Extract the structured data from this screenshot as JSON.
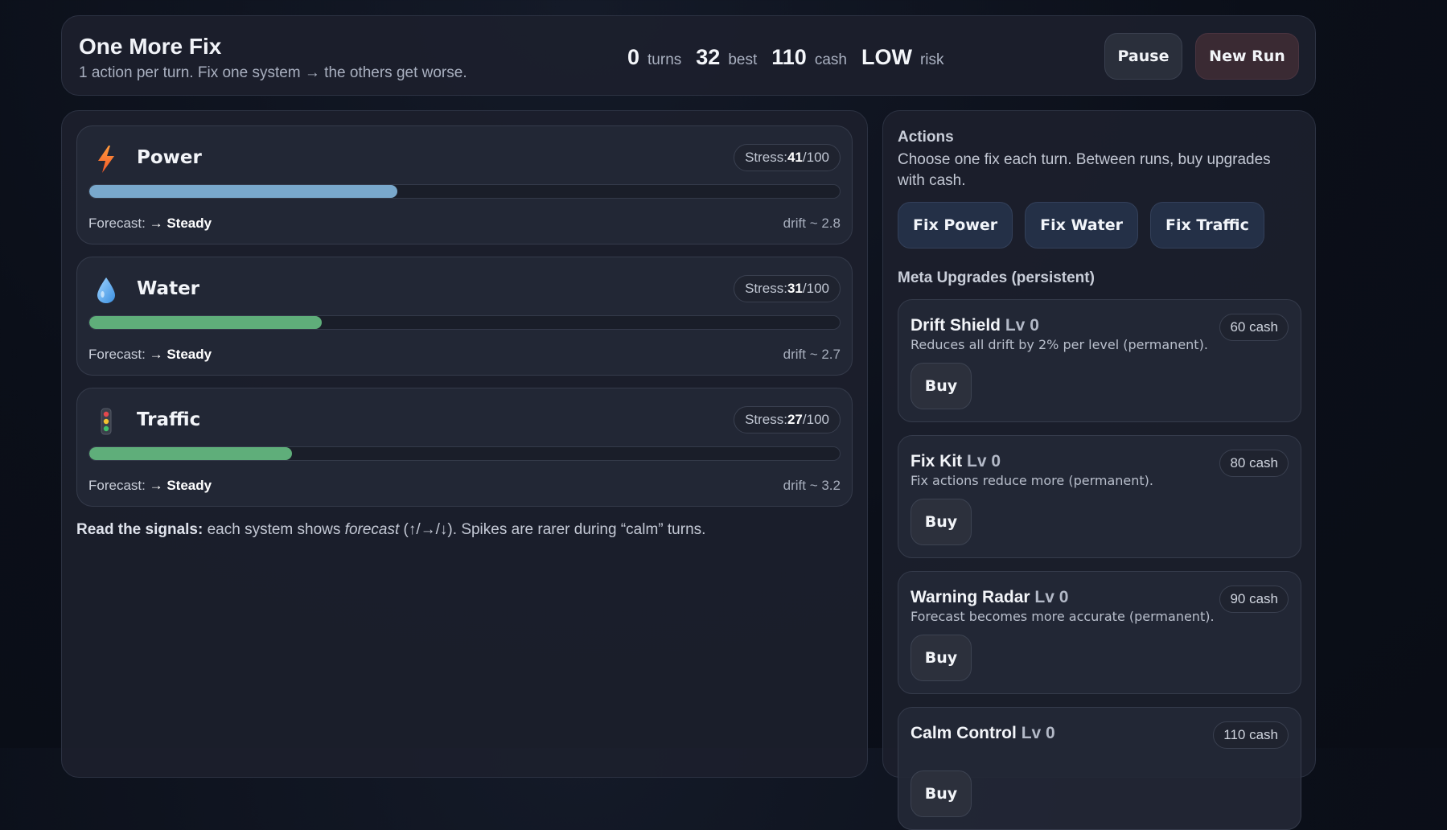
{
  "header": {
    "title": "One More Fix",
    "subtitle": "1 action per turn. Fix one system → the others get worse.",
    "stats": [
      {
        "value": "0",
        "label": "turns"
      },
      {
        "value": "32",
        "label": "best"
      },
      {
        "value": "110",
        "label": "cash"
      },
      {
        "value": "LOW",
        "label": "risk"
      }
    ],
    "pause_label": "Pause",
    "new_run_label": "New Run"
  },
  "systems": [
    {
      "name": "Power",
      "icon": "lightning-bolt-icon",
      "stress": "41",
      "stress_max": "100",
      "stress_prefix": "Stress: ",
      "forecast_prefix": "Forecast: ",
      "forecast": "→ Steady",
      "drift": "drift ~ 2.8",
      "bar_color": "#79a8cc",
      "fill_fraction": 0.41
    },
    {
      "name": "Water",
      "icon": "water-drop-icon",
      "stress": "31",
      "stress_max": "100",
      "stress_prefix": "Stress: ",
      "forecast_prefix": "Forecast: ",
      "forecast": "→ Steady",
      "drift": "drift ~ 2.7",
      "bar_color": "#5fae7a",
      "fill_fraction": 0.31
    },
    {
      "name": "Traffic",
      "icon": "traffic-light-icon",
      "stress": "27",
      "stress_max": "100",
      "stress_prefix": "Stress: ",
      "forecast_prefix": "Forecast: ",
      "forecast": "→ Steady",
      "drift": "drift ~ 3.2",
      "bar_color": "#5fae7a",
      "fill_fraction": 0.27
    }
  ],
  "signals": {
    "bold": "Read the signals:",
    "text1": " each system shows ",
    "italic": "forecast",
    "text2": " (↑/→/↓). Spikes are rarer during “calm” turns."
  },
  "actions": {
    "title": "Actions",
    "description": "Choose one fix each turn. Between runs, buy upgrades with cash.",
    "buttons": [
      "Fix Power",
      "Fix Water",
      "Fix Traffic"
    ]
  },
  "meta": {
    "title": "Meta Upgrades (persistent)",
    "upgrades": [
      {
        "name": "Drift Shield",
        "level": "Lv 0",
        "description": "Reduces all drift by 2% per level (permanent).",
        "cost": "60 cash",
        "buy_label": "Buy"
      },
      {
        "name": "Fix Kit",
        "level": "Lv 0",
        "description": "Fix actions reduce more (permanent).",
        "cost": "80 cash",
        "buy_label": "Buy"
      },
      {
        "name": "Warning Radar",
        "level": "Lv 0",
        "description": "Forecast becomes more accurate (permanent).",
        "cost": "90 cash",
        "buy_label": "Buy"
      },
      {
        "name": "Calm Control",
        "level": "Lv 0",
        "description": "",
        "cost": "110 cash",
        "buy_label": "Buy"
      }
    ]
  }
}
